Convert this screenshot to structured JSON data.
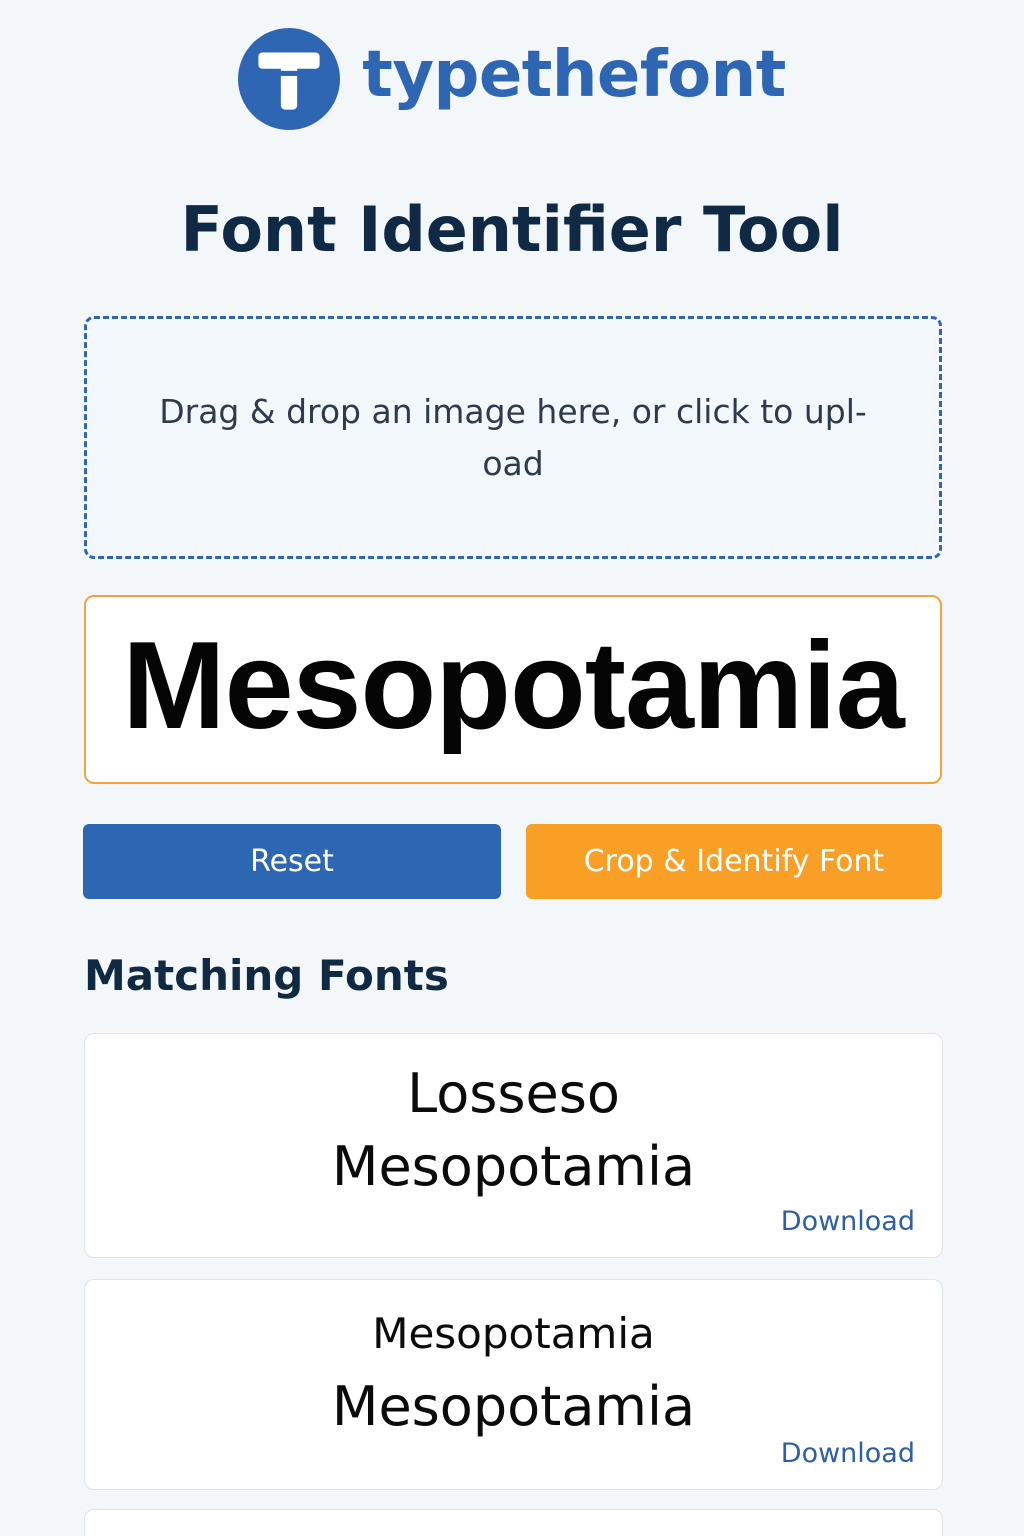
{
  "brand": {
    "name": "typethefont",
    "logo_color": "#2f66b3",
    "logo_icon": "type-t-icon"
  },
  "title": "Font Identifier Tool",
  "upload": {
    "prompt": "Drag & drop an image here, or click to upl- oad",
    "border_color": "#2f66b3"
  },
  "preview": {
    "sample_text": "Mesopotamia",
    "border_color": "#f2a33a"
  },
  "actions": {
    "reset_label": "Reset",
    "identify_label": "Crop & Identify Font",
    "reset_color": "#2d67b3",
    "identify_color": "#f99f26"
  },
  "results": {
    "heading": "Matching Fonts",
    "items": [
      {
        "name": "Losseso",
        "sample": "Mesopotamia",
        "download_label": "Download"
      },
      {
        "name": "Mesopotamia",
        "sample": "Mesopotamia",
        "download_label": "Download"
      }
    ]
  }
}
